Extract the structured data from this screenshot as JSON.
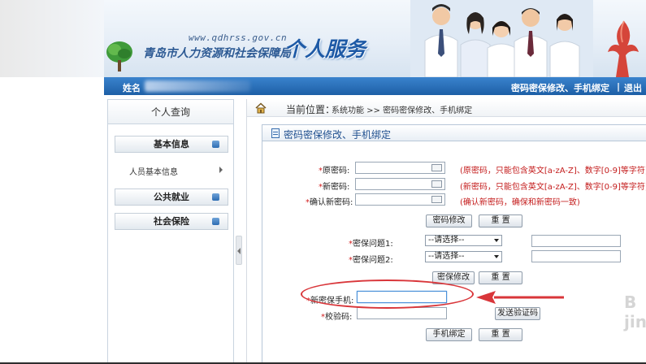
{
  "header": {
    "site_url": "www.qdhrss.gov.cn",
    "org_name": "青岛市人力资源和社会保障局",
    "service_title": "个人服务"
  },
  "topbar": {
    "name_label": "姓名",
    "pwd_link": "密码密保修改、手机绑定",
    "separator": "|",
    "exit_link": "退出"
  },
  "sidebar": {
    "title": "个人查询",
    "groups": [
      {
        "label": "基本信息",
        "items": [
          "人员基本信息"
        ]
      },
      {
        "label": "公共就业"
      },
      {
        "label": "社会保险"
      }
    ]
  },
  "breadcrumb": {
    "label": "当前位置：",
    "path": "系统功能 >> 密码密保修改、手机绑定"
  },
  "panel": {
    "title": "密码密保修改、手机绑定",
    "password": {
      "old_label": "原密码:",
      "new_label": "新密码:",
      "confirm_label": "确认新密码:",
      "old_hint": "(原密码，只能包含英文[a-zA-Z]、数字[0-9]等字符)",
      "new_hint": "(新密码，只能包含英文[a-zA-Z]、数字[0-9]等字符)",
      "confirm_hint": "(确认新密码，确保和新密码一致)",
      "submit": "密码修改",
      "reset": "重 置"
    },
    "security": {
      "q1_label": "密保问题1:",
      "q2_label": "密保问题2:",
      "select_placeholder": "--请选择--",
      "submit": "密保修改",
      "reset": "重 置"
    },
    "phone": {
      "phone_label": "新密保手机:",
      "code_label": "校验码:",
      "send_code": "发送验证码",
      "submit": "手机绑定",
      "reset": "重 置"
    }
  },
  "watermark": "B jin",
  "colors": {
    "brand_blue": "#1d5fa6",
    "hint_red": "#c41c1c",
    "annotation_red": "#d9363a"
  }
}
